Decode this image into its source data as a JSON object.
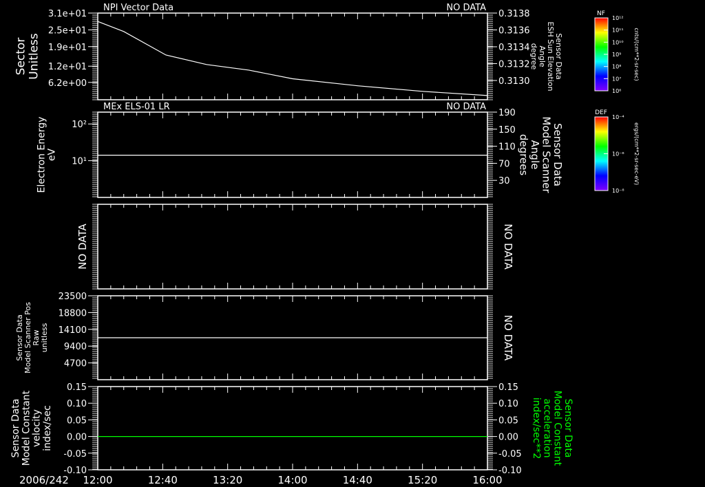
{
  "colors": {
    "background": "#000000",
    "axes": "#ffffff",
    "trace": "#ffffff",
    "accent_green": "#00ff00"
  },
  "date_label": "2006/242",
  "time_ticks": [
    "12:00",
    "12:40",
    "13:20",
    "14:00",
    "14:40",
    "15:20",
    "16:00"
  ],
  "colorbars": [
    {
      "title": "NF",
      "ticks": [
        "10¹²",
        "10¹¹",
        "10¹⁰",
        "10⁹",
        "10⁸",
        "10⁷",
        "10⁶"
      ],
      "unit": "cnts/(cm**2-sr-sec)"
    },
    {
      "title": "DEF",
      "ticks": [
        "10⁻⁴",
        "10⁻⁶",
        "10⁻⁸"
      ],
      "unit": "ergs/(cm**2-sr-sec-eV)"
    }
  ],
  "chart_data": [
    {
      "type": "line",
      "title": "NPI Vector Data",
      "status": "NO DATA",
      "ylabel": [
        "Sector",
        "Unitless"
      ],
      "yticks": [
        "3.1e+01",
        "2.5e+01",
        "1.9e+01",
        "1.2e+01",
        "6.2e+00"
      ],
      "ytick_values": [
        31,
        25,
        19,
        12,
        6.2
      ],
      "ylim": [
        0,
        31
      ],
      "y2label": [
        "Sensor Data",
        "ESH Sun Elevation",
        "Angle",
        "degree"
      ],
      "y2ticks": [
        "0.3138",
        "0.3136",
        "0.3134",
        "0.3132",
        "0.3130"
      ],
      "x": [
        "12:00",
        "12:16",
        "12:42",
        "13:07",
        "13:33",
        "14:00",
        "14:40",
        "15:20",
        "16:00"
      ],
      "values": [
        28,
        24.4,
        16,
        12.6,
        10.6,
        7.5,
        5,
        3,
        1.5
      ]
    },
    {
      "type": "line",
      "title": "MEx ELS-01 LR",
      "status": "NO DATA",
      "ylabel": [
        "Electron Energy",
        "eV"
      ],
      "yscale": "log",
      "yticks": [
        "10²",
        "10¹"
      ],
      "ylim": [
        1,
        210
      ],
      "y2label": [
        "Sensor Data",
        "Model Scanner",
        "Angle",
        "degrees"
      ],
      "y2ticks": [
        "190",
        "150",
        "110",
        "70",
        "30"
      ],
      "y2tick_values": [
        190,
        150,
        110,
        70,
        30
      ],
      "y2lim": [
        -10,
        190
      ],
      "x": [
        "12:00",
        "16:00"
      ],
      "values_y2": [
        89,
        89
      ]
    },
    {
      "type": "line",
      "title": "",
      "ylabel": [
        "NO DATA"
      ],
      "y2label": [
        "NO DATA"
      ]
    },
    {
      "type": "line",
      "ylabel": [
        "Sensor Data",
        "Model Scanner Pos",
        "Raw",
        "unitless"
      ],
      "yticks": [
        "23500",
        "18800",
        "14100",
        "9400",
        "4700"
      ],
      "ytick_values": [
        23500,
        18800,
        14100,
        9400,
        4700
      ],
      "ylim": [
        0,
        23500
      ],
      "y2label": [
        "NO DATA"
      ],
      "x": [
        "12:00",
        "16:00"
      ],
      "values": [
        11750,
        11750
      ]
    },
    {
      "type": "line",
      "ylabel": [
        "Sensor Data",
        "Model Constant",
        "velocity",
        "index/sec"
      ],
      "yticks": [
        "0.15",
        "0.10",
        "0.05",
        "0.00",
        "-0.05",
        "-0.10"
      ],
      "ytick_values": [
        0.15,
        0.1,
        0.05,
        0.0,
        -0.05,
        -0.1
      ],
      "ylim": [
        -0.1,
        0.15
      ],
      "y2label": [
        "Sensor Data",
        "Model Constant",
        "acceleration",
        "index/sec**2"
      ],
      "y2ticks": [
        "0.15",
        "0.10",
        "0.05",
        "0.00",
        "-0.05",
        "-0.10"
      ],
      "x": [
        "12:00",
        "16:00"
      ],
      "values": [
        0,
        0
      ]
    }
  ]
}
